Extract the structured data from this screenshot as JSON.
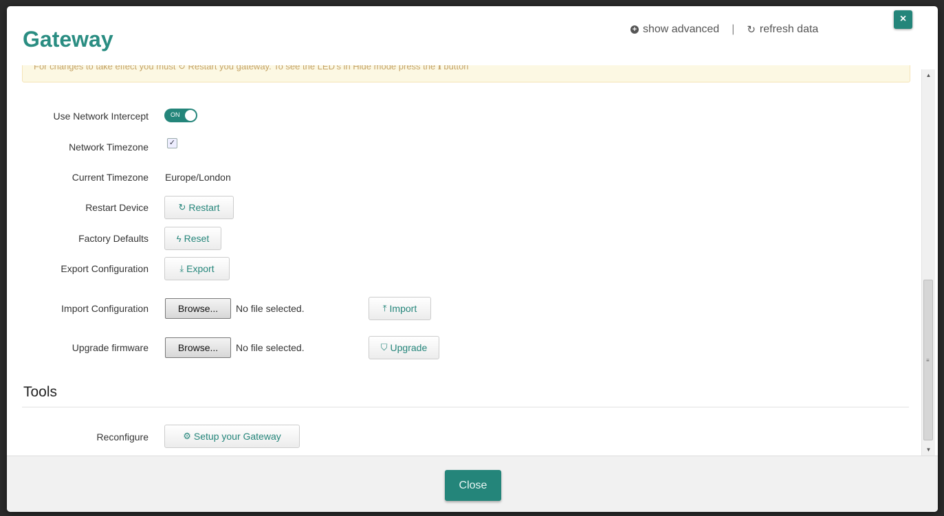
{
  "modal": {
    "title": "Gateway",
    "close_x": "×",
    "header": {
      "show_advanced": "show advanced",
      "separator": "|",
      "refresh_data": "refresh data"
    },
    "alert_text": "For changes to take effect you must ↻ Restart you gateway. To see the LED's in Hide mode press the ℹ button"
  },
  "form": {
    "use_network_intercept": {
      "label": "Use Network Intercept",
      "toggle_text": "ON",
      "value": true
    },
    "network_timezone": {
      "label": "Network Timezone",
      "checked": true
    },
    "current_timezone": {
      "label": "Current Timezone",
      "value": "Europe/London"
    },
    "restart_device": {
      "label": "Restart Device",
      "button": "Restart"
    },
    "factory_defaults": {
      "label": "Factory Defaults",
      "button": "Reset"
    },
    "export_configuration": {
      "label": "Export Configuration",
      "button": "Export"
    },
    "import_configuration": {
      "label": "Import Configuration",
      "browse": "Browse...",
      "file_status": "No file selected.",
      "button": "Import"
    },
    "upgrade_firmware": {
      "label": "Upgrade firmware",
      "browse": "Browse...",
      "file_status": "No file selected.",
      "button": "Upgrade"
    }
  },
  "tools": {
    "title": "Tools",
    "reconfigure": {
      "label": "Reconfigure",
      "button": "Setup your Gateway"
    }
  },
  "footer": {
    "close_button": "Close"
  },
  "colors": {
    "accent": "#24857a",
    "title": "#2a8d82",
    "alert_bg": "#fcf8e3"
  }
}
